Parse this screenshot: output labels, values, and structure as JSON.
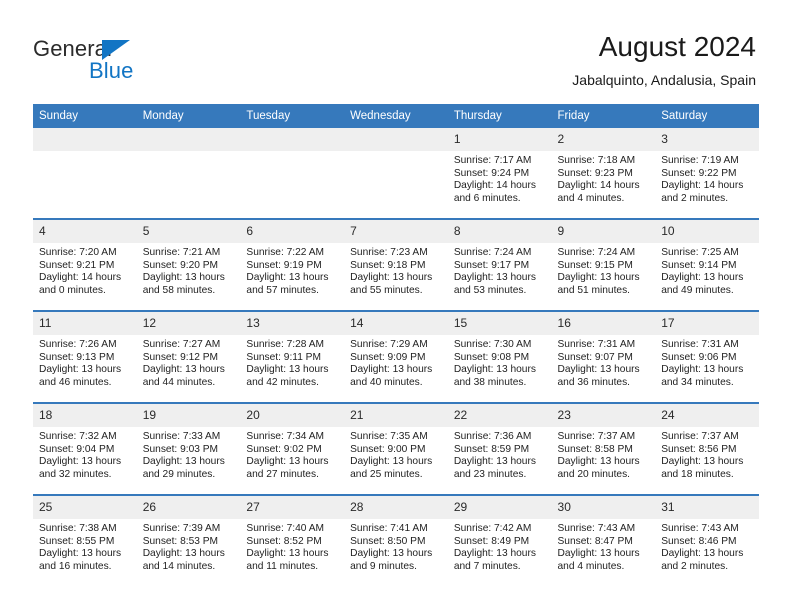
{
  "brand": {
    "name_top": "General",
    "name_bottom": "Blue",
    "triangle_color": "#1275c4"
  },
  "header": {
    "title": "August 2024",
    "subtitle": "Jabalquinto, Andalusia, Spain",
    "accent_color": "#3679bc",
    "daynum_band_color": "#efefef"
  },
  "weekdays": [
    "Sunday",
    "Monday",
    "Tuesday",
    "Wednesday",
    "Thursday",
    "Friday",
    "Saturday"
  ],
  "weeks": [
    [
      {
        "day": "",
        "sunrise": "",
        "sunset": "",
        "daylight": "",
        "empty": true
      },
      {
        "day": "",
        "sunrise": "",
        "sunset": "",
        "daylight": "",
        "empty": true
      },
      {
        "day": "",
        "sunrise": "",
        "sunset": "",
        "daylight": "",
        "empty": true
      },
      {
        "day": "",
        "sunrise": "",
        "sunset": "",
        "daylight": "",
        "empty": true
      },
      {
        "day": "1",
        "sunrise": "Sunrise: 7:17 AM",
        "sunset": "Sunset: 9:24 PM",
        "daylight": "Daylight: 14 hours and 6 minutes.",
        "empty": false
      },
      {
        "day": "2",
        "sunrise": "Sunrise: 7:18 AM",
        "sunset": "Sunset: 9:23 PM",
        "daylight": "Daylight: 14 hours and 4 minutes.",
        "empty": false
      },
      {
        "day": "3",
        "sunrise": "Sunrise: 7:19 AM",
        "sunset": "Sunset: 9:22 PM",
        "daylight": "Daylight: 14 hours and 2 minutes.",
        "empty": false
      }
    ],
    [
      {
        "day": "4",
        "sunrise": "Sunrise: 7:20 AM",
        "sunset": "Sunset: 9:21 PM",
        "daylight": "Daylight: 14 hours and 0 minutes.",
        "empty": false
      },
      {
        "day": "5",
        "sunrise": "Sunrise: 7:21 AM",
        "sunset": "Sunset: 9:20 PM",
        "daylight": "Daylight: 13 hours and 58 minutes.",
        "empty": false
      },
      {
        "day": "6",
        "sunrise": "Sunrise: 7:22 AM",
        "sunset": "Sunset: 9:19 PM",
        "daylight": "Daylight: 13 hours and 57 minutes.",
        "empty": false
      },
      {
        "day": "7",
        "sunrise": "Sunrise: 7:23 AM",
        "sunset": "Sunset: 9:18 PM",
        "daylight": "Daylight: 13 hours and 55 minutes.",
        "empty": false
      },
      {
        "day": "8",
        "sunrise": "Sunrise: 7:24 AM",
        "sunset": "Sunset: 9:17 PM",
        "daylight": "Daylight: 13 hours and 53 minutes.",
        "empty": false
      },
      {
        "day": "9",
        "sunrise": "Sunrise: 7:24 AM",
        "sunset": "Sunset: 9:15 PM",
        "daylight": "Daylight: 13 hours and 51 minutes.",
        "empty": false
      },
      {
        "day": "10",
        "sunrise": "Sunrise: 7:25 AM",
        "sunset": "Sunset: 9:14 PM",
        "daylight": "Daylight: 13 hours and 49 minutes.",
        "empty": false
      }
    ],
    [
      {
        "day": "11",
        "sunrise": "Sunrise: 7:26 AM",
        "sunset": "Sunset: 9:13 PM",
        "daylight": "Daylight: 13 hours and 46 minutes.",
        "empty": false
      },
      {
        "day": "12",
        "sunrise": "Sunrise: 7:27 AM",
        "sunset": "Sunset: 9:12 PM",
        "daylight": "Daylight: 13 hours and 44 minutes.",
        "empty": false
      },
      {
        "day": "13",
        "sunrise": "Sunrise: 7:28 AM",
        "sunset": "Sunset: 9:11 PM",
        "daylight": "Daylight: 13 hours and 42 minutes.",
        "empty": false
      },
      {
        "day": "14",
        "sunrise": "Sunrise: 7:29 AM",
        "sunset": "Sunset: 9:09 PM",
        "daylight": "Daylight: 13 hours and 40 minutes.",
        "empty": false
      },
      {
        "day": "15",
        "sunrise": "Sunrise: 7:30 AM",
        "sunset": "Sunset: 9:08 PM",
        "daylight": "Daylight: 13 hours and 38 minutes.",
        "empty": false
      },
      {
        "day": "16",
        "sunrise": "Sunrise: 7:31 AM",
        "sunset": "Sunset: 9:07 PM",
        "daylight": "Daylight: 13 hours and 36 minutes.",
        "empty": false
      },
      {
        "day": "17",
        "sunrise": "Sunrise: 7:31 AM",
        "sunset": "Sunset: 9:06 PM",
        "daylight": "Daylight: 13 hours and 34 minutes.",
        "empty": false
      }
    ],
    [
      {
        "day": "18",
        "sunrise": "Sunrise: 7:32 AM",
        "sunset": "Sunset: 9:04 PM",
        "daylight": "Daylight: 13 hours and 32 minutes.",
        "empty": false
      },
      {
        "day": "19",
        "sunrise": "Sunrise: 7:33 AM",
        "sunset": "Sunset: 9:03 PM",
        "daylight": "Daylight: 13 hours and 29 minutes.",
        "empty": false
      },
      {
        "day": "20",
        "sunrise": "Sunrise: 7:34 AM",
        "sunset": "Sunset: 9:02 PM",
        "daylight": "Daylight: 13 hours and 27 minutes.",
        "empty": false
      },
      {
        "day": "21",
        "sunrise": "Sunrise: 7:35 AM",
        "sunset": "Sunset: 9:00 PM",
        "daylight": "Daylight: 13 hours and 25 minutes.",
        "empty": false
      },
      {
        "day": "22",
        "sunrise": "Sunrise: 7:36 AM",
        "sunset": "Sunset: 8:59 PM",
        "daylight": "Daylight: 13 hours and 23 minutes.",
        "empty": false
      },
      {
        "day": "23",
        "sunrise": "Sunrise: 7:37 AM",
        "sunset": "Sunset: 8:58 PM",
        "daylight": "Daylight: 13 hours and 20 minutes.",
        "empty": false
      },
      {
        "day": "24",
        "sunrise": "Sunrise: 7:37 AM",
        "sunset": "Sunset: 8:56 PM",
        "daylight": "Daylight: 13 hours and 18 minutes.",
        "empty": false
      }
    ],
    [
      {
        "day": "25",
        "sunrise": "Sunrise: 7:38 AM",
        "sunset": "Sunset: 8:55 PM",
        "daylight": "Daylight: 13 hours and 16 minutes.",
        "empty": false
      },
      {
        "day": "26",
        "sunrise": "Sunrise: 7:39 AM",
        "sunset": "Sunset: 8:53 PM",
        "daylight": "Daylight: 13 hours and 14 minutes.",
        "empty": false
      },
      {
        "day": "27",
        "sunrise": "Sunrise: 7:40 AM",
        "sunset": "Sunset: 8:52 PM",
        "daylight": "Daylight: 13 hours and 11 minutes.",
        "empty": false
      },
      {
        "day": "28",
        "sunrise": "Sunrise: 7:41 AM",
        "sunset": "Sunset: 8:50 PM",
        "daylight": "Daylight: 13 hours and 9 minutes.",
        "empty": false
      },
      {
        "day": "29",
        "sunrise": "Sunrise: 7:42 AM",
        "sunset": "Sunset: 8:49 PM",
        "daylight": "Daylight: 13 hours and 7 minutes.",
        "empty": false
      },
      {
        "day": "30",
        "sunrise": "Sunrise: 7:43 AM",
        "sunset": "Sunset: 8:47 PM",
        "daylight": "Daylight: 13 hours and 4 minutes.",
        "empty": false
      },
      {
        "day": "31",
        "sunrise": "Sunrise: 7:43 AM",
        "sunset": "Sunset: 8:46 PM",
        "daylight": "Daylight: 13 hours and 2 minutes.",
        "empty": false
      }
    ]
  ]
}
